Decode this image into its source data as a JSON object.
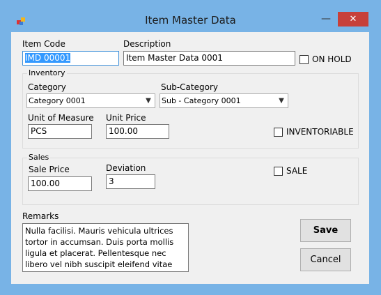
{
  "window": {
    "title": "Item Master Data",
    "minimize_glyph": "—",
    "close_glyph": "✕"
  },
  "labels": {
    "item_code": "Item Code",
    "description": "Description",
    "on_hold": "ON HOLD",
    "category": "Category",
    "sub_category": "Sub-Category",
    "unit_of_measure": "Unit of Measure",
    "unit_price": "Unit Price",
    "inventoriable": "INVENTORIABLE",
    "sale_price": "Sale Price",
    "deviation": "Deviation",
    "sale": "SALE",
    "remarks": "Remarks"
  },
  "groups": {
    "inventory": "Inventory",
    "sales": "Sales"
  },
  "values": {
    "item_code": "IMD 00001",
    "description": "Item Master Data 0001",
    "category": "Category 0001",
    "sub_category": "Sub - Category 0001",
    "unit_of_measure": "PCS",
    "unit_price": "100.00",
    "sale_price": "100.00",
    "deviation": "3",
    "remarks": "Nulla facilisi. Mauris vehicula ultrices tortor in accumsan. Duis porta mollis ligula et placerat. Pellentesque nec libero vel nibh suscipit eleifend vitae vel tellus. Nulla sed"
  },
  "checkboxes": {
    "on_hold": false,
    "inventoriable": false,
    "sale": false
  },
  "buttons": {
    "save": "Save",
    "cancel": "Cancel"
  },
  "colors": {
    "window_frame": "#78b3e6",
    "close_button": "#c7403a",
    "selection": "#3399ff"
  }
}
